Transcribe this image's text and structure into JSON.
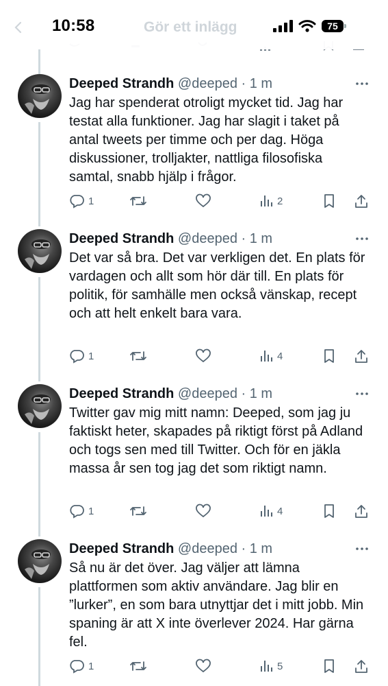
{
  "status": {
    "time": "10:58",
    "battery": "75"
  },
  "header": {
    "title": "Gör ett inlägg"
  },
  "tweets": [
    {
      "name": "Deeped Strandh",
      "handle": "@deeped",
      "time": "· 1 m",
      "text": "Jag har spenderat otroligt mycket tid. Jag har testat alla funktioner. Jag har slagit i taket på antal tweets per timme och per dag. Höga diskussioner, trolljakter, nattliga filosofiska samtal, snabb hjälp i frågor.",
      "replies": "1",
      "views": "2"
    },
    {
      "name": "Deeped Strandh",
      "handle": "@deeped",
      "time": "· 1 m",
      "text": "Det var så bra. Det var verkligen det. En plats för vardagen och allt som hör där till. En plats för politik, för samhälle men också vänskap, recept och att helt enkelt bara vara.",
      "replies": "1",
      "views": "4"
    },
    {
      "name": "Deeped Strandh",
      "handle": "@deeped",
      "time": "· 1 m",
      "text": "Twitter gav mig mitt namn: Deeped, som jag ju faktiskt heter, skapades på riktigt först på Adland och togs sen med till Twitter. Och för en jäkla massa år sen tog jag det som riktigt namn.",
      "replies": "1",
      "views": "4"
    },
    {
      "name": "Deeped Strandh",
      "handle": "@deeped",
      "time": "· 1 m",
      "text": "Så nu är det över. Jag väljer att lämna plattformen som aktiv användare. Jag blir en ”lurker”, en som bara utnyttjar det i mitt jobb. Min spaning är att X inte överlever 2024. Har gärna fel.",
      "replies": "1",
      "views": "5"
    }
  ],
  "icons": {
    "reply": "speech-bubble-icon",
    "retweet": "retweet-icon",
    "like": "heart-icon",
    "views": "bar-chart-icon",
    "bookmark": "bookmark-icon",
    "share": "share-icon",
    "more": "more-dots-icon"
  },
  "colors": {
    "text": "#0f1419",
    "muted": "#536471",
    "thread": "#cfd9de"
  }
}
